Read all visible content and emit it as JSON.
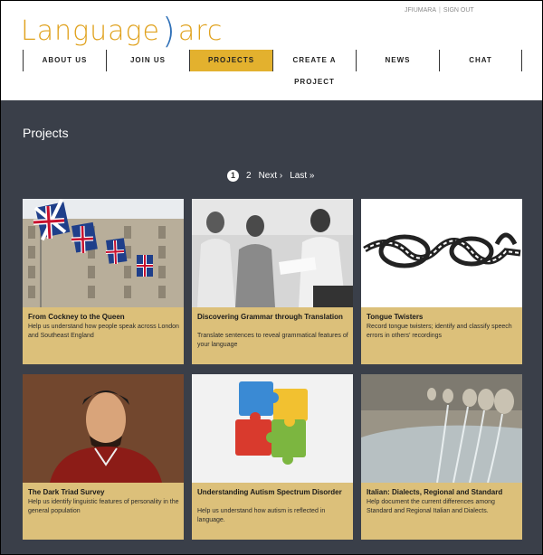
{
  "brand": {
    "logo_left": "Language",
    "logo_right": "arc",
    "logo_bracket": ")"
  },
  "user_links": {
    "user": "JFIUMARA",
    "separator": "|",
    "signout": "SIGN OUT"
  },
  "nav": [
    {
      "label": "ABOUT US",
      "active": false
    },
    {
      "label": "JOIN US",
      "active": false
    },
    {
      "label": "PROJECTS",
      "active": true
    },
    {
      "label": "CREATE A PROJECT",
      "active": false
    },
    {
      "label": "NEWS",
      "active": false
    },
    {
      "label": "CHAT",
      "active": false
    }
  ],
  "page_title": "Projects",
  "pager": {
    "current": "1",
    "page2": "2",
    "next": "Next ›",
    "last": "Last »"
  },
  "projects": [
    {
      "title": "From Cockney to the Queen",
      "desc": "Help us understand how people speak across London and Southeast England"
    },
    {
      "title": "Discovering Grammar through Translation",
      "desc": "Translate sentences to reveal grammatical features of your language"
    },
    {
      "title": "Tongue Twisters",
      "desc": "Record tongue twisters; identify and classify speech errors in others' recordings"
    },
    {
      "title": "The Dark Triad Survey",
      "desc": "Help us identify linguistic features of personality in the general population"
    },
    {
      "title": "Understanding Autism Spectrum Disorder",
      "desc": "Help us understand how autism is reflected in language."
    },
    {
      "title": "Italian: Dialects, Regional and Standard",
      "desc": "Help document the current differences among Standard and Regional Italian and Dialects."
    }
  ],
  "colors": {
    "accent": "#e3b12e",
    "background": "#3a3f49",
    "card": "#dcc07a",
    "logo_orange": "#e0a21e",
    "logo_blue": "#2d6fb7"
  }
}
